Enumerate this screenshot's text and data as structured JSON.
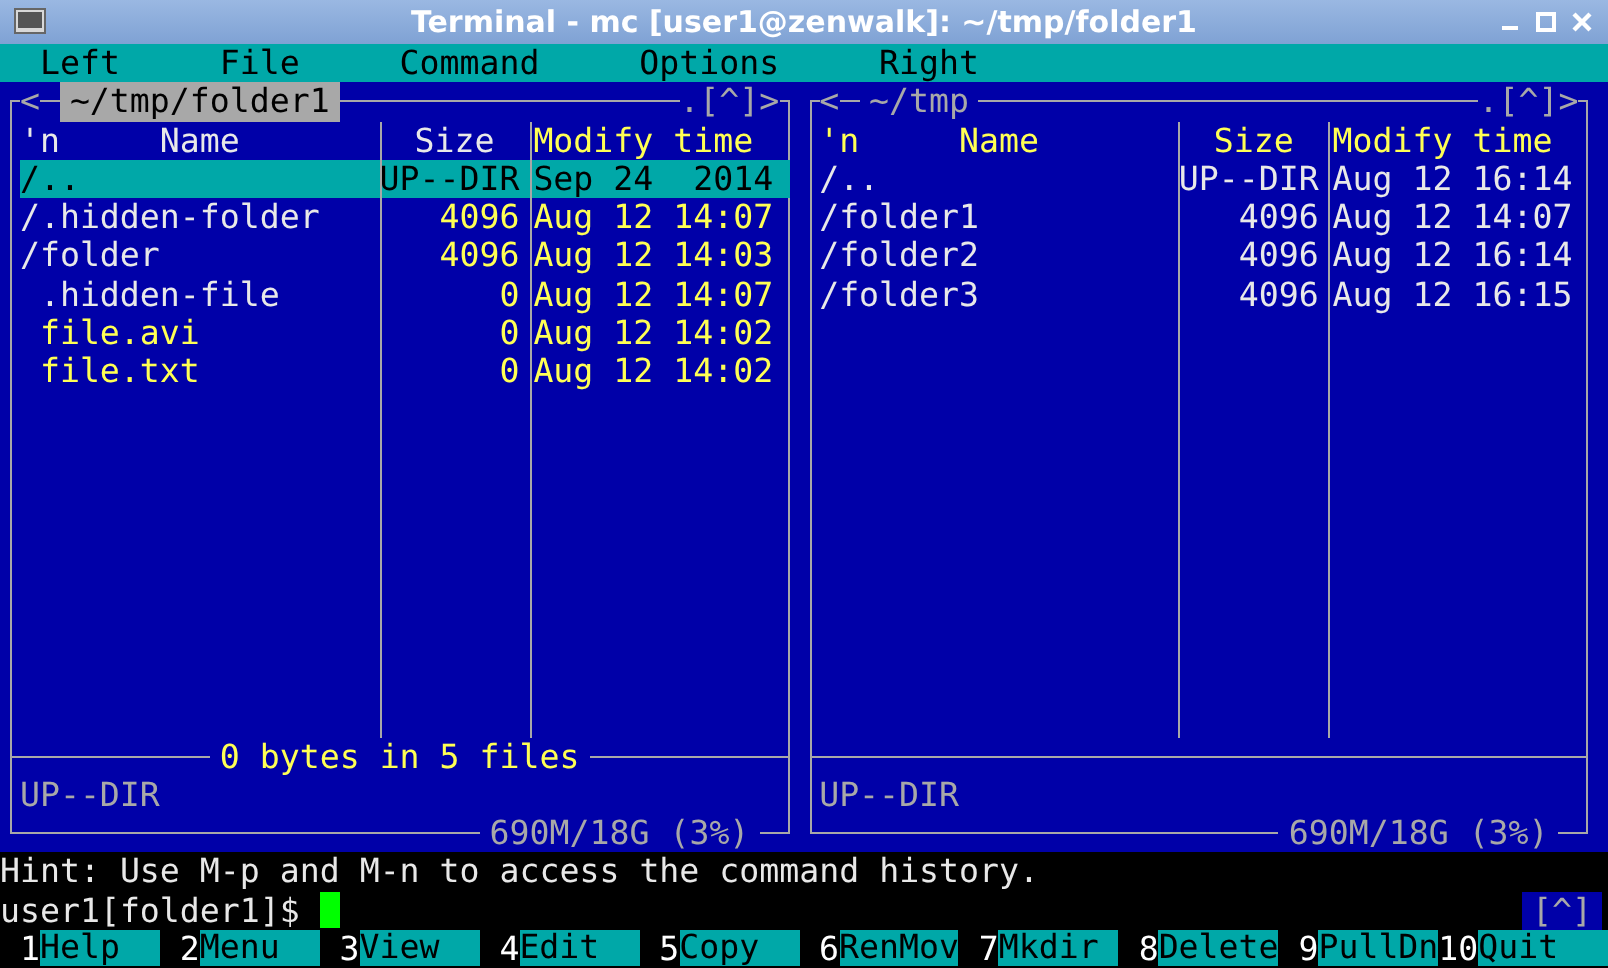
{
  "window": {
    "title": "Terminal - mc [user1@zenwalk]: ~/tmp/folder1"
  },
  "menu": [
    "Left",
    "File",
    "Command",
    "Options",
    "Right"
  ],
  "panels": [
    {
      "active": true,
      "left_arrow": "<",
      "path": "~/tmp/folder1",
      "corner_controls": ".[^]>",
      "columns": [
        {
          "sort_mark": "'n",
          "label": "Name",
          "highlighted": false
        },
        {
          "label": "Size",
          "highlighted": false
        },
        {
          "label": "Modify time",
          "highlighted": true
        }
      ],
      "rows": [
        {
          "name": "/..",
          "size": "UP--DIR",
          "time": "Sep 24  2014",
          "selected": true
        },
        {
          "name": "/.hidden-folder",
          "size": "4096",
          "time": "Aug 12 14:07",
          "kind": "dir",
          "marked": true,
          "selected": false
        },
        {
          "name": "/folder",
          "size": "4096",
          "time": "Aug 12 14:03",
          "kind": "dir",
          "marked": true,
          "selected": false
        },
        {
          "name": " .hidden-file",
          "size": "0",
          "time": "Aug 12 14:07",
          "kind": "hidden",
          "marked": true,
          "selected": false
        },
        {
          "name": " file.avi",
          "size": "0",
          "time": "Aug 12 14:02",
          "kind": "file",
          "marked": true,
          "selected": false
        },
        {
          "name": " file.txt",
          "size": "0",
          "time": "Aug 12 14:02",
          "kind": "file",
          "marked": true,
          "selected": false
        }
      ],
      "summary": "0 bytes in 5 files",
      "status": "UP--DIR",
      "disk": "690M/18G (3%)"
    },
    {
      "active": false,
      "left_arrow": "<",
      "path": "~/tmp",
      "corner_controls": ".[^]>",
      "columns": [
        {
          "sort_mark": "'n",
          "label": "Name",
          "highlighted": true
        },
        {
          "label": "Size",
          "highlighted": true
        },
        {
          "label": "Modify time",
          "highlighted": true
        }
      ],
      "rows": [
        {
          "name": "/..",
          "size": "UP--DIR",
          "time": "Aug 12 16:14",
          "kind": "dir",
          "marked": false,
          "selected": false
        },
        {
          "name": "/folder1",
          "size": "4096",
          "time": "Aug 12 14:07",
          "kind": "dir",
          "marked": false,
          "selected": false
        },
        {
          "name": "/folder2",
          "size": "4096",
          "time": "Aug 12 16:14",
          "kind": "dir",
          "marked": false,
          "selected": false
        },
        {
          "name": "/folder3",
          "size": "4096",
          "time": "Aug 12 16:15",
          "kind": "dir",
          "marked": false,
          "selected": false
        }
      ],
      "status": "UP--DIR",
      "disk": "690M/18G (3%)"
    }
  ],
  "hint": "Hint: Use M-p and M-n to access the command history.",
  "prompt": "user1[folder1]$",
  "prompt_corner": "[^]",
  "function_keys": [
    {
      "number": "1",
      "label": "Help"
    },
    {
      "number": "2",
      "label": "Menu"
    },
    {
      "number": "3",
      "label": "View"
    },
    {
      "number": "4",
      "label": "Edit"
    },
    {
      "number": "5",
      "label": "Copy"
    },
    {
      "number": "6",
      "label": "RenMov"
    },
    {
      "number": "7",
      "label": "Mkdir"
    },
    {
      "number": "8",
      "label": "Delete"
    },
    {
      "number": "9",
      "label": "PullDn"
    },
    {
      "number": "10",
      "label": "Quit"
    }
  ]
}
